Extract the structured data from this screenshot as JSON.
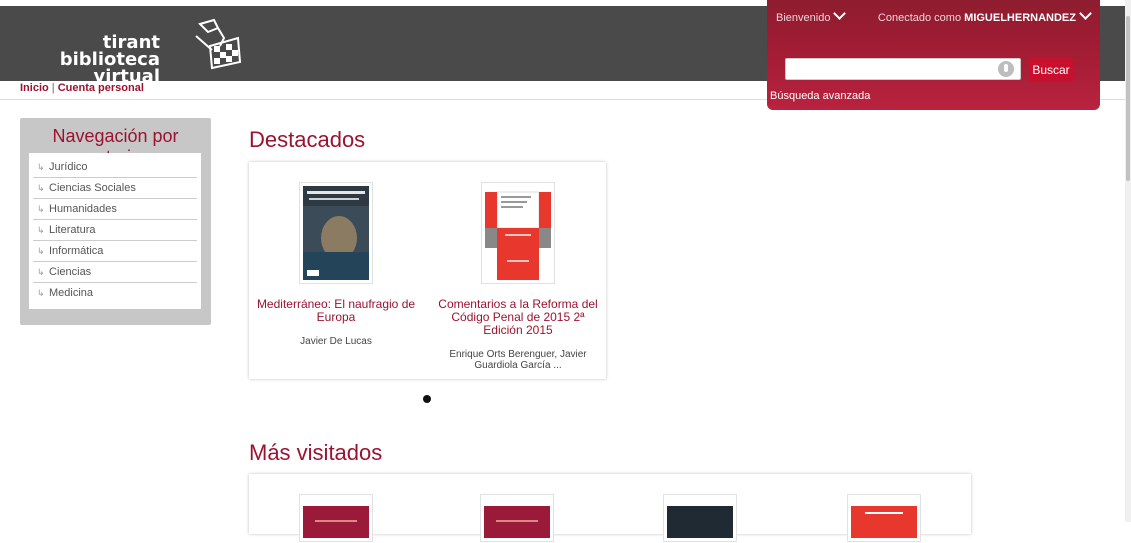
{
  "logo": {
    "line1": "tirant",
    "line2": "biblioteca virtual"
  },
  "breadcrumb": {
    "home": "Inicio",
    "separator": "|",
    "account": "Cuenta personal"
  },
  "user_panel": {
    "welcome": "Bienvenido",
    "connected_prefix": "Conectado como",
    "username": "MIGUELHERNANDEZ",
    "search_value": "",
    "search_button": "Buscar",
    "advanced_search": "Búsqueda avanzada"
  },
  "sidebar": {
    "title": "Navegación por materias",
    "items": [
      "Jurídico",
      "Ciencias Sociales",
      "Humanidades",
      "Literatura",
      "Informática",
      "Ciencias",
      "Medicina"
    ]
  },
  "featured": {
    "title": "Destacados",
    "books": [
      {
        "title": "Mediterráneo: El naufragio de Europa",
        "author": "Javier De Lucas"
      },
      {
        "title": "Comentarios a la Reforma del Código Penal de 2015 2ª Edición 2015",
        "author": "Enrique Orts Berenguer, Javier Guardiola García ..."
      }
    ]
  },
  "most_visited": {
    "title": "Más visitados"
  },
  "colors": {
    "accent": "#9b1330",
    "header_bg": "#4a4a4a",
    "panel": "#a81d36"
  }
}
